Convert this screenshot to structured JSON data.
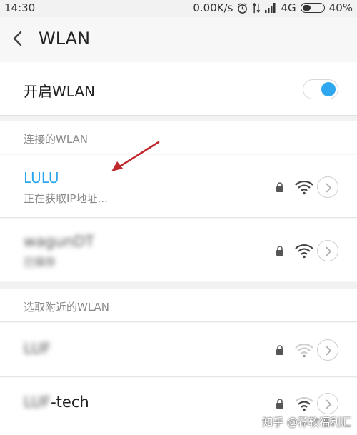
{
  "status_bar": {
    "time": "14:30",
    "network_speed": "0.00K/s",
    "network_type": "4G",
    "battery": "40%",
    "battery_level": 0.4
  },
  "header": {
    "title": "WLAN",
    "back_icon": "chevron-left-icon"
  },
  "wlan_toggle": {
    "label": "开启WLAN",
    "on": true,
    "accent_color": "#2fa7ee"
  },
  "connected_section": {
    "title": "连接的WLAN",
    "networks": [
      {
        "name": "LULU",
        "status": "正在获取IP地址...",
        "secured": true,
        "signal": "strong",
        "active": true
      },
      {
        "name": "wagunDT",
        "status": "已保存",
        "secured": true,
        "signal": "strong",
        "obscured": true
      }
    ]
  },
  "nearby_section": {
    "title": "选取附近的WLAN",
    "networks": [
      {
        "name": "LUF",
        "secured": true,
        "signal": "weak",
        "obscured": true
      },
      {
        "name_obscured_part": "LUF",
        "name_visible_part": "-tech",
        "secured": true,
        "signal": "medium"
      }
    ]
  },
  "annotation": {
    "arrow_color": "#c0282d"
  },
  "watermark": "知乎 @荐软福利汇"
}
